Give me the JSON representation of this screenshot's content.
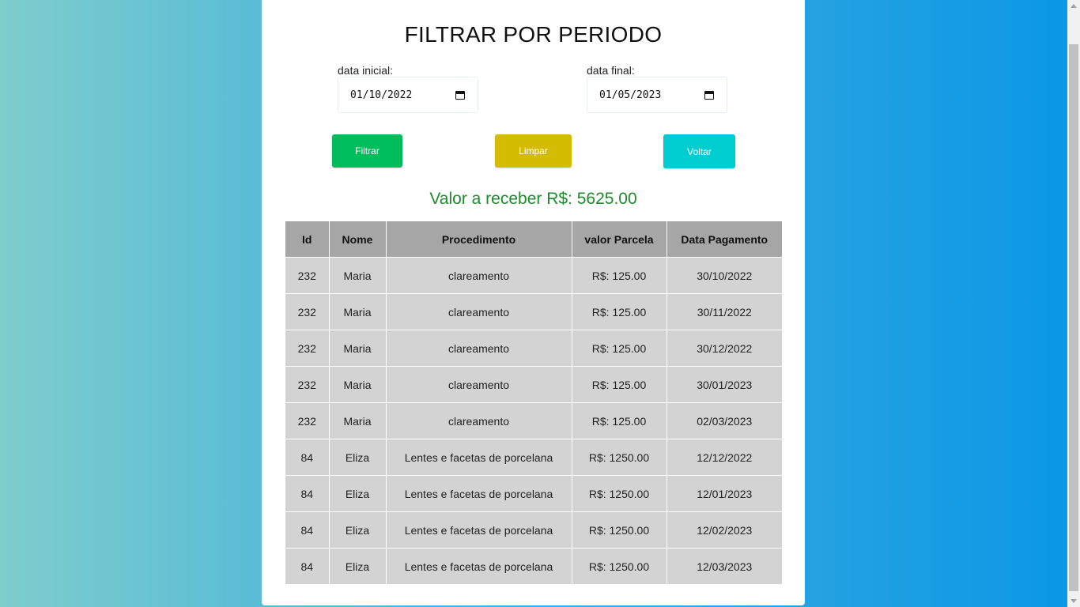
{
  "page": {
    "title": "FILTRAR POR PERIODO"
  },
  "filters": {
    "start_label": "data inicial:",
    "start_value": "01/10/2022",
    "end_label": "data final:",
    "end_value": "01/05/2023"
  },
  "buttons": {
    "filter": "Filtrar",
    "clear": "Limpar",
    "back": "Voltar"
  },
  "summary": {
    "total_text": "Valor a receber R$: 5625.00"
  },
  "table": {
    "headers": [
      "Id",
      "Nome",
      "Procedimento",
      "valor Parcela",
      "Data Pagamento"
    ],
    "rows": [
      [
        "232",
        "Maria",
        "clareamento",
        "R$: 125.00",
        "30/10/2022"
      ],
      [
        "232",
        "Maria",
        "clareamento",
        "R$: 125.00",
        "30/11/2022"
      ],
      [
        "232",
        "Maria",
        "clareamento",
        "R$: 125.00",
        "30/12/2022"
      ],
      [
        "232",
        "Maria",
        "clareamento",
        "R$: 125.00",
        "30/01/2023"
      ],
      [
        "232",
        "Maria",
        "clareamento",
        "R$: 125.00",
        "02/03/2023"
      ],
      [
        "84",
        "Eliza",
        "Lentes e facetas de porcelana",
        "R$: 1250.00",
        "12/12/2022"
      ],
      [
        "84",
        "Eliza",
        "Lentes e facetas de porcelana",
        "R$: 1250.00",
        "12/01/2023"
      ],
      [
        "84",
        "Eliza",
        "Lentes e facetas de porcelana",
        "R$: 1250.00",
        "12/02/2023"
      ],
      [
        "84",
        "Eliza",
        "Lentes e facetas de porcelana",
        "R$: 1250.00",
        "12/03/2023"
      ]
    ]
  },
  "colors": {
    "filter_button": "#00bd5b",
    "clear_button": "#d4bd00",
    "back_button": "#00cdd0",
    "total_text": "#1d8a2c"
  }
}
